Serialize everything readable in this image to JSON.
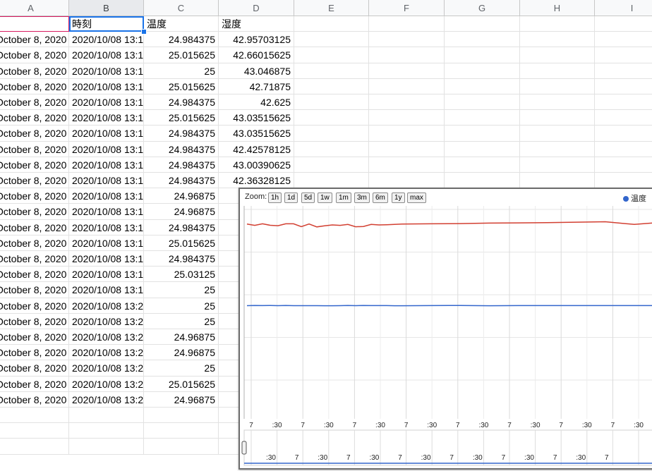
{
  "columns": [
    "A",
    "B",
    "C",
    "D",
    "E",
    "F",
    "G",
    "H",
    "I"
  ],
  "header_row": {
    "a": "",
    "b": "時刻",
    "c": "温度",
    "d": "湿度"
  },
  "rows": [
    {
      "a": "October 8, 2020",
      "b": "2020/10/08 13:1",
      "c": "24.984375",
      "d": "42.95703125"
    },
    {
      "a": "October 8, 2020",
      "b": "2020/10/08 13:1",
      "c": "25.015625",
      "d": "42.66015625"
    },
    {
      "a": "October 8, 2020",
      "b": "2020/10/08 13:1",
      "c": "25",
      "d": "43.046875"
    },
    {
      "a": "October 8, 2020",
      "b": "2020/10/08 13:1",
      "c": "25.015625",
      "d": "42.71875"
    },
    {
      "a": "October 8, 2020",
      "b": "2020/10/08 13:1",
      "c": "24.984375",
      "d": "42.625"
    },
    {
      "a": "October 8, 2020",
      "b": "2020/10/08 13:1",
      "c": "25.015625",
      "d": "43.03515625"
    },
    {
      "a": "October 8, 2020",
      "b": "2020/10/08 13:1",
      "c": "24.984375",
      "d": "43.03515625"
    },
    {
      "a": "October 8, 2020",
      "b": "2020/10/08 13:1",
      "c": "24.984375",
      "d": "42.42578125"
    },
    {
      "a": "October 8, 2020",
      "b": "2020/10/08 13:1",
      "c": "24.984375",
      "d": "43.00390625"
    },
    {
      "a": "October 8, 2020",
      "b": "2020/10/08 13:1",
      "c": "24.984375",
      "d": "42.36328125"
    },
    {
      "a": "October 8, 2020",
      "b": "2020/10/08 13:1",
      "c": "24.96875",
      "d": ""
    },
    {
      "a": "October 8, 2020",
      "b": "2020/10/08 13:1",
      "c": "24.96875",
      "d": ""
    },
    {
      "a": "October 8, 2020",
      "b": "2020/10/08 13:1",
      "c": "24.984375",
      "d": ""
    },
    {
      "a": "October 8, 2020",
      "b": "2020/10/08 13:1",
      "c": "25.015625",
      "d": ""
    },
    {
      "a": "October 8, 2020",
      "b": "2020/10/08 13:1",
      "c": "24.984375",
      "d": ""
    },
    {
      "a": "October 8, 2020",
      "b": "2020/10/08 13:1",
      "c": "25.03125",
      "d": ""
    },
    {
      "a": "October 8, 2020",
      "b": "2020/10/08 13:1",
      "c": "25",
      "d": ""
    },
    {
      "a": "October 8, 2020",
      "b": "2020/10/08 13:2",
      "c": "25",
      "d": ""
    },
    {
      "a": "October 8, 2020",
      "b": "2020/10/08 13:2",
      "c": "25",
      "d": ""
    },
    {
      "a": "October 8, 2020",
      "b": "2020/10/08 13:2",
      "c": "24.96875",
      "d": ""
    },
    {
      "a": "October 8, 2020",
      "b": "2020/10/08 13:2",
      "c": "24.96875",
      "d": ""
    },
    {
      "a": "October 8, 2020",
      "b": "2020/10/08 13:2",
      "c": "25",
      "d": ""
    },
    {
      "a": "October 8, 2020",
      "b": "2020/10/08 13:2",
      "c": "25.015625",
      "d": ""
    },
    {
      "a": "October 8, 2020",
      "b": "2020/10/08 13:2",
      "c": "24.96875",
      "d": ""
    }
  ],
  "chart": {
    "zoom_label": "Zoom:",
    "zoom_buttons": [
      "1h",
      "1d",
      "5d",
      "1w",
      "1m",
      "3m",
      "6m",
      "1y",
      "max"
    ],
    "legend": "温度",
    "x_ticks": [
      "7",
      ":30",
      "7",
      ":30",
      "7",
      ":30",
      "7",
      ":30",
      "7",
      ":30",
      "7",
      ":30",
      "7",
      ":30",
      "7",
      ":30"
    ],
    "range_ticks": [
      ":30",
      "7",
      ":30",
      "7",
      ":30",
      "7",
      ":30",
      "7",
      ":30",
      "7",
      ":30",
      "7",
      ":30",
      "7"
    ],
    "colors": {
      "red_series": "#d23f31",
      "blue_series": "#3366cc"
    }
  },
  "chart_data": {
    "type": "line",
    "series": [
      {
        "name": "",
        "color": "#d23f31",
        "values": [
          43.0,
          42.7,
          43.05,
          42.72,
          42.63,
          43.04,
          43.04,
          42.43,
          43.0,
          42.36,
          42.6,
          42.8,
          42.7,
          42.9,
          42.4,
          42.45,
          42.9,
          42.8,
          42.85,
          42.9,
          43.0,
          43.05,
          43.1,
          43.2,
          43.25,
          43.3,
          43.4,
          43.5,
          42.9,
          43.4
        ]
      },
      {
        "name": "温度",
        "color": "#3366cc",
        "values": [
          24.98,
          25.02,
          25.0,
          25.02,
          24.98,
          25.02,
          24.98,
          24.98,
          24.98,
          24.98,
          24.97,
          24.97,
          24.98,
          25.02,
          24.98,
          25.03,
          25.0,
          25.0,
          25.0,
          24.97,
          24.97,
          25.0,
          25.02,
          24.97,
          25.0,
          25.0,
          25.0,
          25.0,
          25.0,
          25.0
        ]
      }
    ],
    "title": "",
    "xlabel": "",
    "ylabel": ""
  }
}
